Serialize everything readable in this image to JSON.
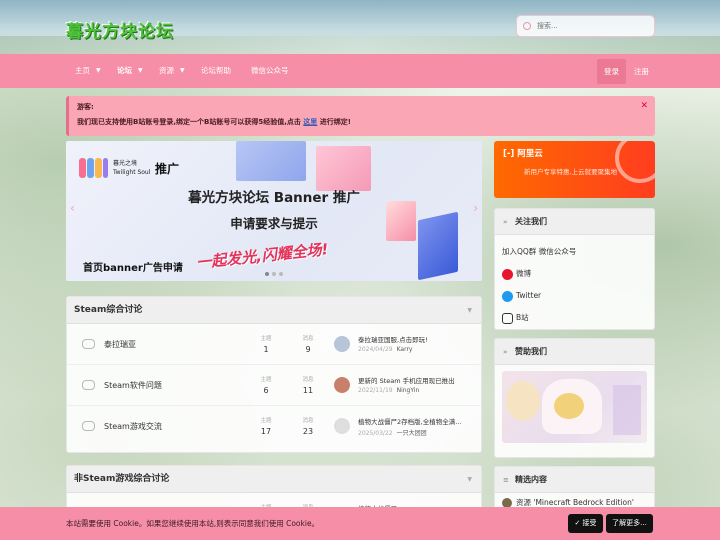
{
  "site": {
    "logo_text": "暮光方块论坛",
    "search_placeholder": "搜索..."
  },
  "nav": {
    "items": [
      {
        "label": "主页",
        "dropdown": true,
        "active": false
      },
      {
        "label": "论坛",
        "dropdown": true,
        "active": true
      },
      {
        "label": "资源",
        "dropdown": true,
        "active": false
      },
      {
        "label": "论坛帮助",
        "dropdown": false,
        "active": false
      },
      {
        "label": "微信公众号",
        "dropdown": false,
        "active": false
      }
    ],
    "login": "登录",
    "register": "注册"
  },
  "notice": {
    "title": "游客:",
    "text_before": "我们现已支持使用B站账号登录,绑定一个B站账号可以获得5经验值,点击",
    "link": "这里",
    "text_after": "进行绑定!",
    "close_icon": "close-icon"
  },
  "banner": {
    "logo_cn": "暮光之境",
    "logo_en": "Twilight Soul",
    "tui": "推广",
    "title": "暮光方块论坛 Banner 推广",
    "subtitle": "申请要求与提示",
    "slogan": "一起发光,闪耀全场!",
    "apply": "首页banner广告申请",
    "slides": 3,
    "active_slide": 1
  },
  "categories": [
    {
      "title": "Steam综合讨论",
      "forums": [
        {
          "name": "泰拉瑞亚",
          "threads_label": "主题",
          "threads": "1",
          "posts_label": "消息",
          "posts": "9",
          "last_title": "泰拉瑞亚国服,点击即玩!",
          "last_date": "2024/04/29",
          "last_user": "Karry",
          "avatar_color": "#b8c4d8"
        },
        {
          "name": "Steam软件问题",
          "threads_label": "主题",
          "threads": "6",
          "posts_label": "消息",
          "posts": "11",
          "last_title": "更新的 Steam 手机应用现已推出",
          "last_date": "2022/11/19",
          "last_user": "NingYin",
          "avatar_color": "#c9806a"
        },
        {
          "name": "Steam游戏交流",
          "threads_label": "主题",
          "threads": "17",
          "posts_label": "消息",
          "posts": "23",
          "last_title": "植物大战僵尸2存档版,全植物全满...",
          "last_date": "2025/03/22",
          "last_user": "一只大团团",
          "avatar_color": "#dedede"
        }
      ]
    },
    {
      "title": "非Steam游戏综合讨论",
      "forums": [
        {
          "name": "",
          "threads_label": "主题",
          "threads": "",
          "posts_label": "消息",
          "posts": "",
          "last_title": "植物大战僵尸...",
          "last_date": "",
          "last_user": "",
          "avatar_color": "#dedede"
        }
      ]
    }
  ],
  "sidebar": {
    "ad": {
      "brand": "阿里云",
      "text": "新用户专享特惠,上云就要聚集地"
    },
    "follow": {
      "title": "关注我们",
      "line1": "加入QQ群 微信公众号",
      "weibo": "微博",
      "twitter": "Twitter",
      "bilibili": "B站"
    },
    "sponsor": {
      "title": "赞助我们"
    },
    "featured": {
      "title": "精选内容",
      "item": "资源 'Minecraft Bedrock Edition'"
    }
  },
  "cookie": {
    "text": "本站需要使用 Cookie。如果您继续使用本站,则表示同意我们使用 Cookie。",
    "accept": "✓ 接受",
    "more": "了解更多..."
  },
  "colors": {
    "accent": "#f78ea7",
    "notice_bg": "#fba6b4",
    "logo_green": "#4ec43a",
    "ad_orange": "#ff6a00"
  }
}
